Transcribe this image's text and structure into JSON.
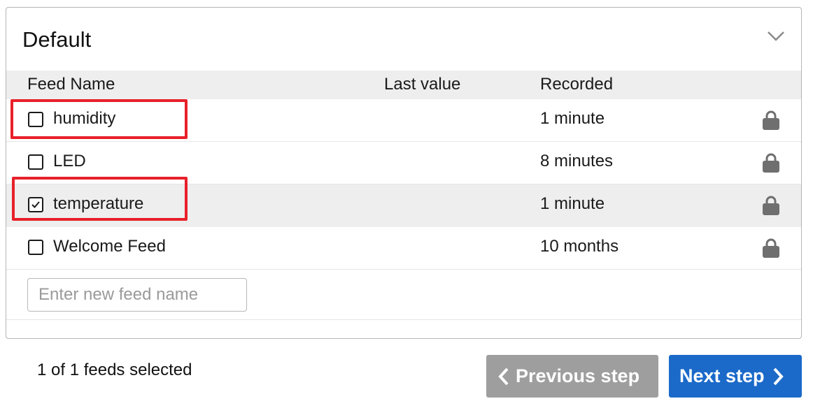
{
  "panel": {
    "title": "Default",
    "collapse_icon": "chevron-down-icon"
  },
  "table": {
    "headers": {
      "feed_name": "Feed Name",
      "last_value": "Last value",
      "recorded": "Recorded"
    },
    "rows": [
      {
        "name": "humidity",
        "last_value": "",
        "recorded": "1 minute",
        "checked": false,
        "icon": "lock-icon"
      },
      {
        "name": "LED",
        "last_value": "",
        "recorded": "8 minutes",
        "checked": false,
        "icon": "lock-icon"
      },
      {
        "name": "temperature",
        "last_value": "",
        "recorded": "1 minute",
        "checked": true,
        "icon": "lock-icon"
      },
      {
        "name": "Welcome Feed",
        "last_value": "",
        "recorded": "10 months",
        "checked": false,
        "icon": "lock-icon"
      }
    ]
  },
  "new_feed": {
    "placeholder": "Enter new feed name",
    "value": ""
  },
  "footer": {
    "status": "1 of 1 feeds selected",
    "previous_label": "Previous step",
    "next_label": "Next step"
  },
  "colors": {
    "highlight": "#e8202a",
    "next_button": "#1b6ac9",
    "previous_button": "#9e9e9e"
  }
}
